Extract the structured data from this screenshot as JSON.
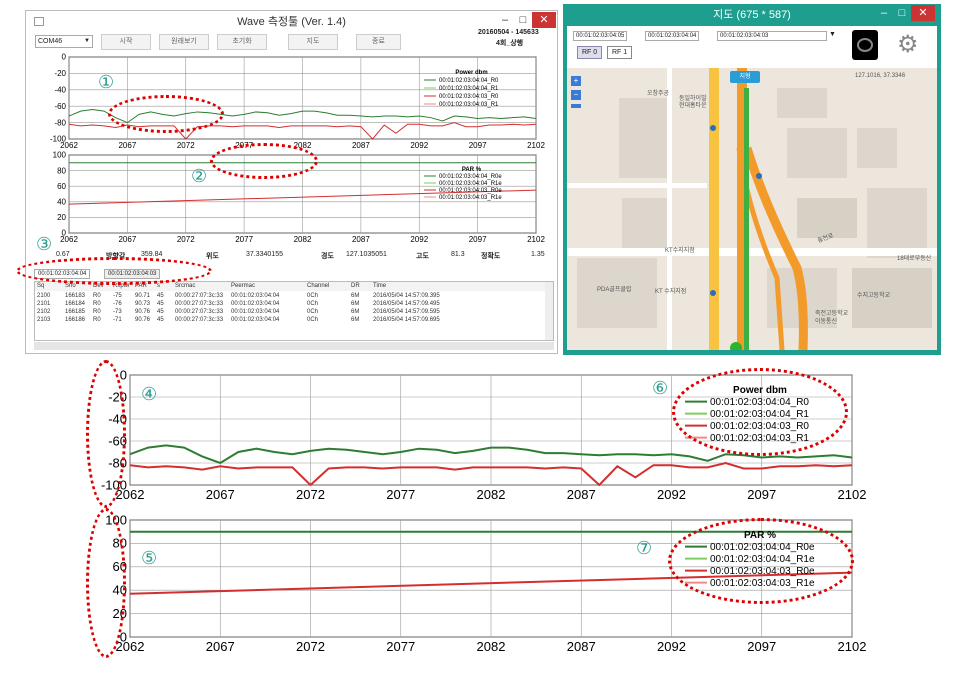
{
  "wave_window": {
    "title": "Wave 측정툴 (Ver. 1.4)",
    "port": "COM46",
    "buttons": [
      "시작",
      "원래보기",
      "초기화",
      "지도",
      "종료"
    ],
    "datetime_line1": "20160504 - 145633",
    "datetime_line2": "4회_상행",
    "chart1_title": "Power dbm",
    "chart2_title": "PAR %",
    "chart1_legend": [
      "00:01:02:03:04:04_R0",
      "00:01:02:03:04:04_R1",
      "00:01:02:03:04:03_R0",
      "00:01:02:03:04:03_R1"
    ],
    "chart2_legend": [
      "00:01:02:03:04:04_R0e",
      "00:01:02:03:04:04_R1e",
      "00:01:02:03:04:03_R0e",
      "00:01:02:03:04:03_R1e"
    ],
    "status": {
      "v1": "0.67",
      "lbl_bearing": "방향각",
      "v_bearing": "359.84",
      "lbl_lat": "위도",
      "v_lat": "37.3340155",
      "lbl_lon": "경도",
      "v_lon": "127.1035051",
      "lbl_alt": "고도",
      "v_alt": "81.3",
      "lbl_acc": "정확도",
      "v_acc": "1.35"
    },
    "tabs": [
      "00:01:02:03:04:04",
      "00:01:02:03:04:03"
    ],
    "table_headers": [
      "Sq",
      "Sno",
      "Dev",
      "Rxpwr",
      "PAR",
      "s",
      "Srcmac",
      "Peermac",
      "Channel",
      "DR",
      "Time"
    ],
    "table_rows": [
      [
        "2100",
        "166183",
        "R0",
        "-75",
        "90.71",
        "45",
        "00:00:27:07:3c:33",
        "00:01:02:03:04:04",
        "0Ch",
        "6M",
        "2016/05/04 14:57:09.395"
      ],
      [
        "2101",
        "166184",
        "R0",
        "-76",
        "90.73",
        "45",
        "00:00:27:07:3c:33",
        "00:01:02:03:04:04",
        "0Ch",
        "6M",
        "2016/05/04 14:57:09.495"
      ],
      [
        "2102",
        "166185",
        "R0",
        "-73",
        "90.76",
        "45",
        "00:00:27:07:3c:33",
        "00:01:02:03:04:04",
        "0Ch",
        "6M",
        "2016/05/04 14:57:09.595"
      ],
      [
        "2103",
        "166186",
        "R0",
        "-71",
        "90.76",
        "45",
        "00:00:27:07:3c:33",
        "00:01:02:03:04:04",
        "0Ch",
        "6M",
        "2016/05/04 14:57:09.695"
      ]
    ]
  },
  "map_window": {
    "title": "지도 (675 * 587)",
    "id_fields": [
      "00:01:02:03:04:05",
      "00:01:02:03:04:04",
      "00:01:02:03:04:03"
    ],
    "rf_buttons": [
      "RF 0",
      "RF 1"
    ],
    "toggle_label": "지형",
    "coords": "127.1016, 37.3346",
    "labels": [
      "오창주공",
      "동일하이빌",
      "현대홈타운",
      "KT수지지점",
      "PDA골프클럽",
      "KT 수지지점",
      "수지고등학교",
      "죽전고등학교",
      "이동통신",
      "18대로부동산",
      "동천로"
    ]
  },
  "annotations": [
    "①",
    "②",
    "③",
    "④",
    "⑤",
    "⑥",
    "⑦"
  ],
  "chart_data": [
    {
      "type": "line",
      "title": "Power dbm",
      "xlim": [
        2062,
        2102
      ],
      "ylim": [
        -100,
        0
      ],
      "x_ticks": [
        2062,
        2067,
        2072,
        2077,
        2082,
        2087,
        2092,
        2097,
        2102
      ],
      "y_ticks": [
        0,
        -20,
        -40,
        -60,
        -80,
        -100
      ],
      "x": [
        2062,
        2063,
        2064,
        2065,
        2066,
        2067,
        2068,
        2069,
        2070,
        2071,
        2072,
        2073,
        2074,
        2075,
        2076,
        2077,
        2078,
        2079,
        2080,
        2081,
        2082,
        2083,
        2084,
        2085,
        2086,
        2087,
        2088,
        2089,
        2090,
        2091,
        2092,
        2093,
        2094,
        2095,
        2096,
        2097,
        2098,
        2099,
        2100,
        2101,
        2102
      ],
      "series": [
        {
          "name": "00:01:02:03:04:04_R0",
          "color": "#2e7d32",
          "values": [
            -72,
            -66,
            -64,
            -66,
            -74,
            -80,
            -70,
            -67,
            -70,
            -72,
            -69,
            -67,
            -68,
            -70,
            -72,
            -70,
            -67,
            -68,
            -71,
            -69,
            -66,
            -66,
            -68,
            -71,
            -71,
            -72,
            -73,
            -72,
            -72,
            -73,
            -72,
            -74,
            -78,
            -72,
            -73,
            -75,
            -74,
            -75,
            -74,
            -73,
            -75
          ]
        },
        {
          "name": "00:01:02:03:04:03_R0",
          "color": "#d32f2f",
          "values": [
            -82,
            -84,
            -83,
            -84,
            -86,
            -83,
            -85,
            -84,
            -84,
            -84,
            -100,
            -85,
            -84,
            -84,
            -85,
            -84,
            -84,
            -84,
            -86,
            -84,
            -84,
            -84,
            -84,
            -85,
            -84,
            -85,
            -100,
            -83,
            -93,
            -82,
            -82,
            -84,
            -84,
            -80,
            -85,
            -85,
            -83,
            -83,
            -82,
            -83,
            -82
          ]
        }
      ]
    },
    {
      "type": "line",
      "title": "PAR %",
      "xlim": [
        2062,
        2102
      ],
      "ylim": [
        0,
        100
      ],
      "x_ticks": [
        2062,
        2067,
        2072,
        2077,
        2082,
        2087,
        2092,
        2097,
        2102
      ],
      "y_ticks": [
        100,
        80,
        60,
        40,
        20,
        0
      ],
      "x": [
        2062,
        2102
      ],
      "series": [
        {
          "name": "00:01:02:03:04:04_R0e",
          "color": "#2e7d32",
          "values": [
            90,
            90
          ]
        },
        {
          "name": "00:01:02:03:04:03_R0e",
          "color": "#d32f2f",
          "values": [
            37,
            55
          ]
        }
      ]
    }
  ]
}
